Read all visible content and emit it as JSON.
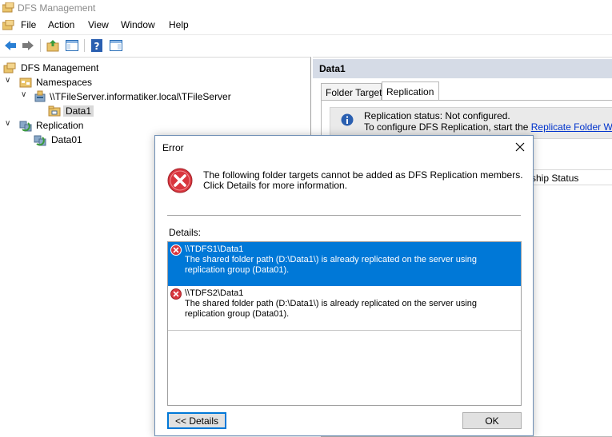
{
  "window": {
    "title": "DFS Management"
  },
  "menu": [
    "File",
    "Action",
    "View",
    "Window",
    "Help"
  ],
  "toolbar": {
    "icons": [
      "back-icon",
      "forward-icon",
      "up-folder-icon",
      "show-hide-tree-icon",
      "help-icon",
      "action-pane-icon"
    ]
  },
  "tree": {
    "root": "DFS Management",
    "namespaces": "Namespaces",
    "namespace_path": "\\\\TFileServer.informatiker.local\\TFileServer",
    "folder": "Data1",
    "replication": "Replication",
    "group": "Data01"
  },
  "right_pane": {
    "header": "Data1",
    "tabs": [
      "Folder Targets",
      "Replication"
    ],
    "active_tab": "Replication",
    "status_line": "Replication status: Not configured.",
    "configure_prefix": "To configure DFS Replication, start the ",
    "configure_link": "Replicate Folder Wizard",
    "configure_suffix": ".",
    "column_header_partial": "rship Status"
  },
  "dialog": {
    "title": "Error",
    "message": "The following folder targets cannot be added as DFS Replication members. Click Details for more information.",
    "details_label": "Details:",
    "items": [
      {
        "title": "\\\\TDFS1\\Data1",
        "message": "The shared folder path (D:\\Data1\\) is already replicated on the server using replication group (Data01)."
      },
      {
        "title": "\\\\TDFS2\\Data1",
        "message": "The shared folder path (D:\\Data1\\) is already replicated on the server using replication group (Data01)."
      }
    ],
    "details_button": "<< Details",
    "ok_button": "OK"
  },
  "colors": {
    "selection": "#0078d7",
    "header_band": "#d5dbe6",
    "error_red": "#d9363e",
    "link": "#0033cc"
  }
}
